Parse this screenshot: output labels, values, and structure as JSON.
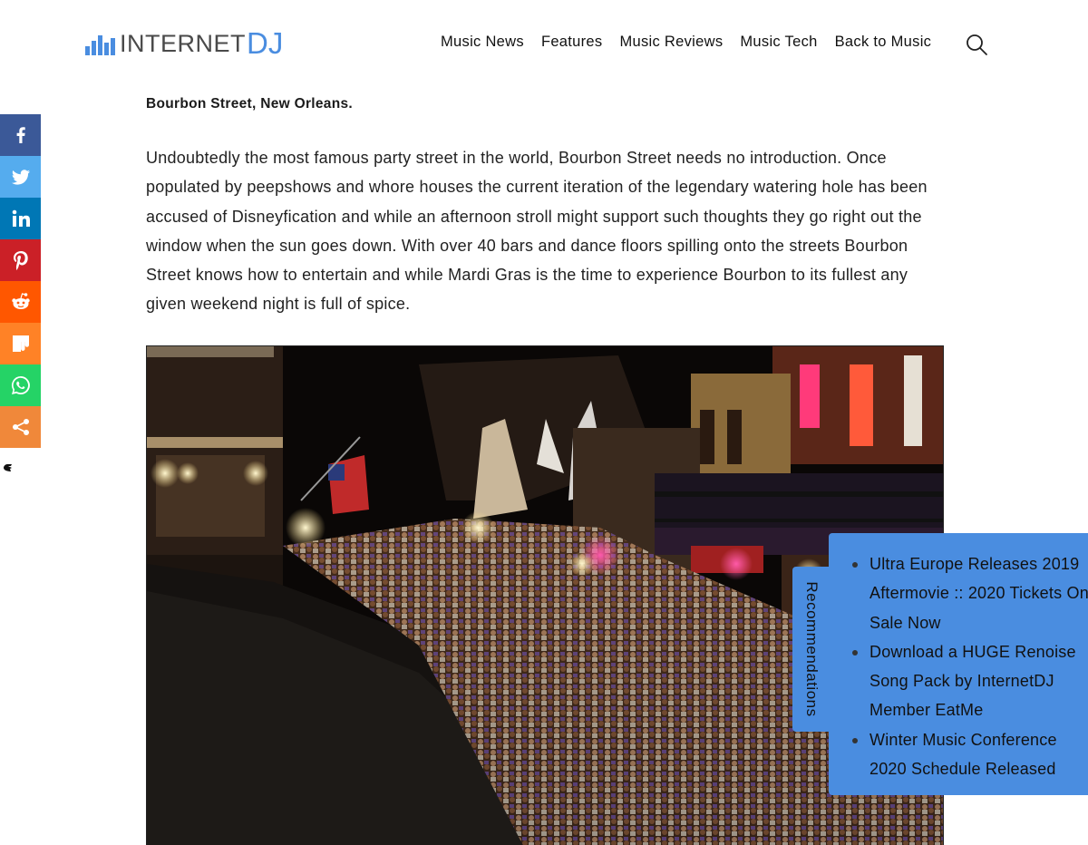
{
  "header": {
    "logo_text_1": "INTERNET",
    "logo_text_2": "DJ",
    "nav": [
      {
        "label": "Music News"
      },
      {
        "label": "Features"
      },
      {
        "label": "Music Reviews"
      },
      {
        "label": "Music Tech"
      },
      {
        "label": "Back to Music"
      }
    ],
    "search_icon": "search-icon"
  },
  "share": [
    {
      "network": "facebook",
      "icon": "facebook-icon",
      "color": "#3b5998"
    },
    {
      "network": "twitter",
      "icon": "twitter-icon",
      "color": "#55acee"
    },
    {
      "network": "linkedin",
      "icon": "linkedin-icon",
      "color": "#0077b5"
    },
    {
      "network": "pinterest",
      "icon": "pinterest-icon",
      "color": "#cb2027"
    },
    {
      "network": "reddit",
      "icon": "reddit-icon",
      "color": "#ff5700"
    },
    {
      "network": "mix",
      "icon": "mix-icon",
      "color": "#ff8226"
    },
    {
      "network": "whatsapp",
      "icon": "whatsapp-icon",
      "color": "#25d366"
    },
    {
      "network": "more",
      "icon": "share-icon",
      "color": "#f0883a"
    }
  ],
  "article": {
    "caption": "Bourbon Street, New Orleans.",
    "paragraph": "Undoubtedly the most famous party street in the world, Bourbon Street needs no introduction. Once populated by peepshows and whore houses the current iteration of the legendary watering hole has been accused of Disneyfication and while an afternoon stroll might support such thoughts they go right out the window when the sun goes down. With over 40 bars and dance floors spilling onto the streets Bourbon Street knows how to entertain and while Mardi Gras is the time to experience Bourbon to its fullest any given weekend night is full of spice."
  },
  "recommendations": {
    "tab_label": "Recommendations",
    "items": [
      {
        "title": "Ultra Europe Releases 2019 Aftermovie :: 2020 Tickets On Sale Now"
      },
      {
        "title": "Download a HUGE Renoise Song Pack by InternetDJ Member EatMe"
      },
      {
        "title": "Winter Music Conference 2020 Schedule Released"
      }
    ]
  },
  "colors": {
    "brand_blue": "#4a8de0",
    "widget_bg": "#4a8de0"
  }
}
